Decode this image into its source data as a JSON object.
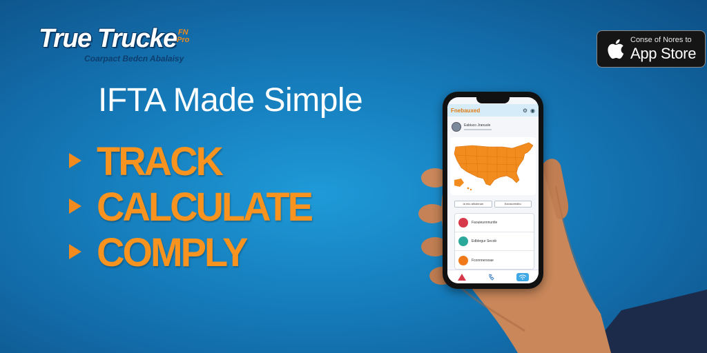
{
  "logo": {
    "main": "True Trucke",
    "badge_top": "FN",
    "badge_bottom": "Pro",
    "subtitle": "Coarpact Bedcn Abalaisy"
  },
  "app_store": {
    "small_text": "Conse of Nores to",
    "big_text": "App Store",
    "icon": "apple-icon"
  },
  "headline": "IFTA Made Simple",
  "features": [
    {
      "label": "TRACK",
      "icon": "arrow-right-icon"
    },
    {
      "label": "CALCULATE",
      "icon": "arrow-right-icon"
    },
    {
      "label": "COMPLY",
      "icon": "arrow-right-icon"
    }
  ],
  "phone": {
    "app_title": "Fnebauxed",
    "profile_name": "Eabiuco Jranusle",
    "toggles": [
      "Ia mio ailtobrnan",
      "Eclosiorhidbu"
    ],
    "list_items": [
      {
        "label": "Faouieunnnuntle",
        "color": "#d63a4a"
      },
      {
        "label": "Edbbrgur Secob",
        "color": "#2aa89a"
      },
      {
        "label": "Fconnnersoae",
        "color": "#f07a1a"
      }
    ],
    "nav_icons": [
      "alert-icon",
      "phone-icon",
      "wifi-icon"
    ]
  },
  "colors": {
    "background": "#1579b8",
    "accent_orange": "#f7931e",
    "map_orange": "#f28c1e"
  }
}
